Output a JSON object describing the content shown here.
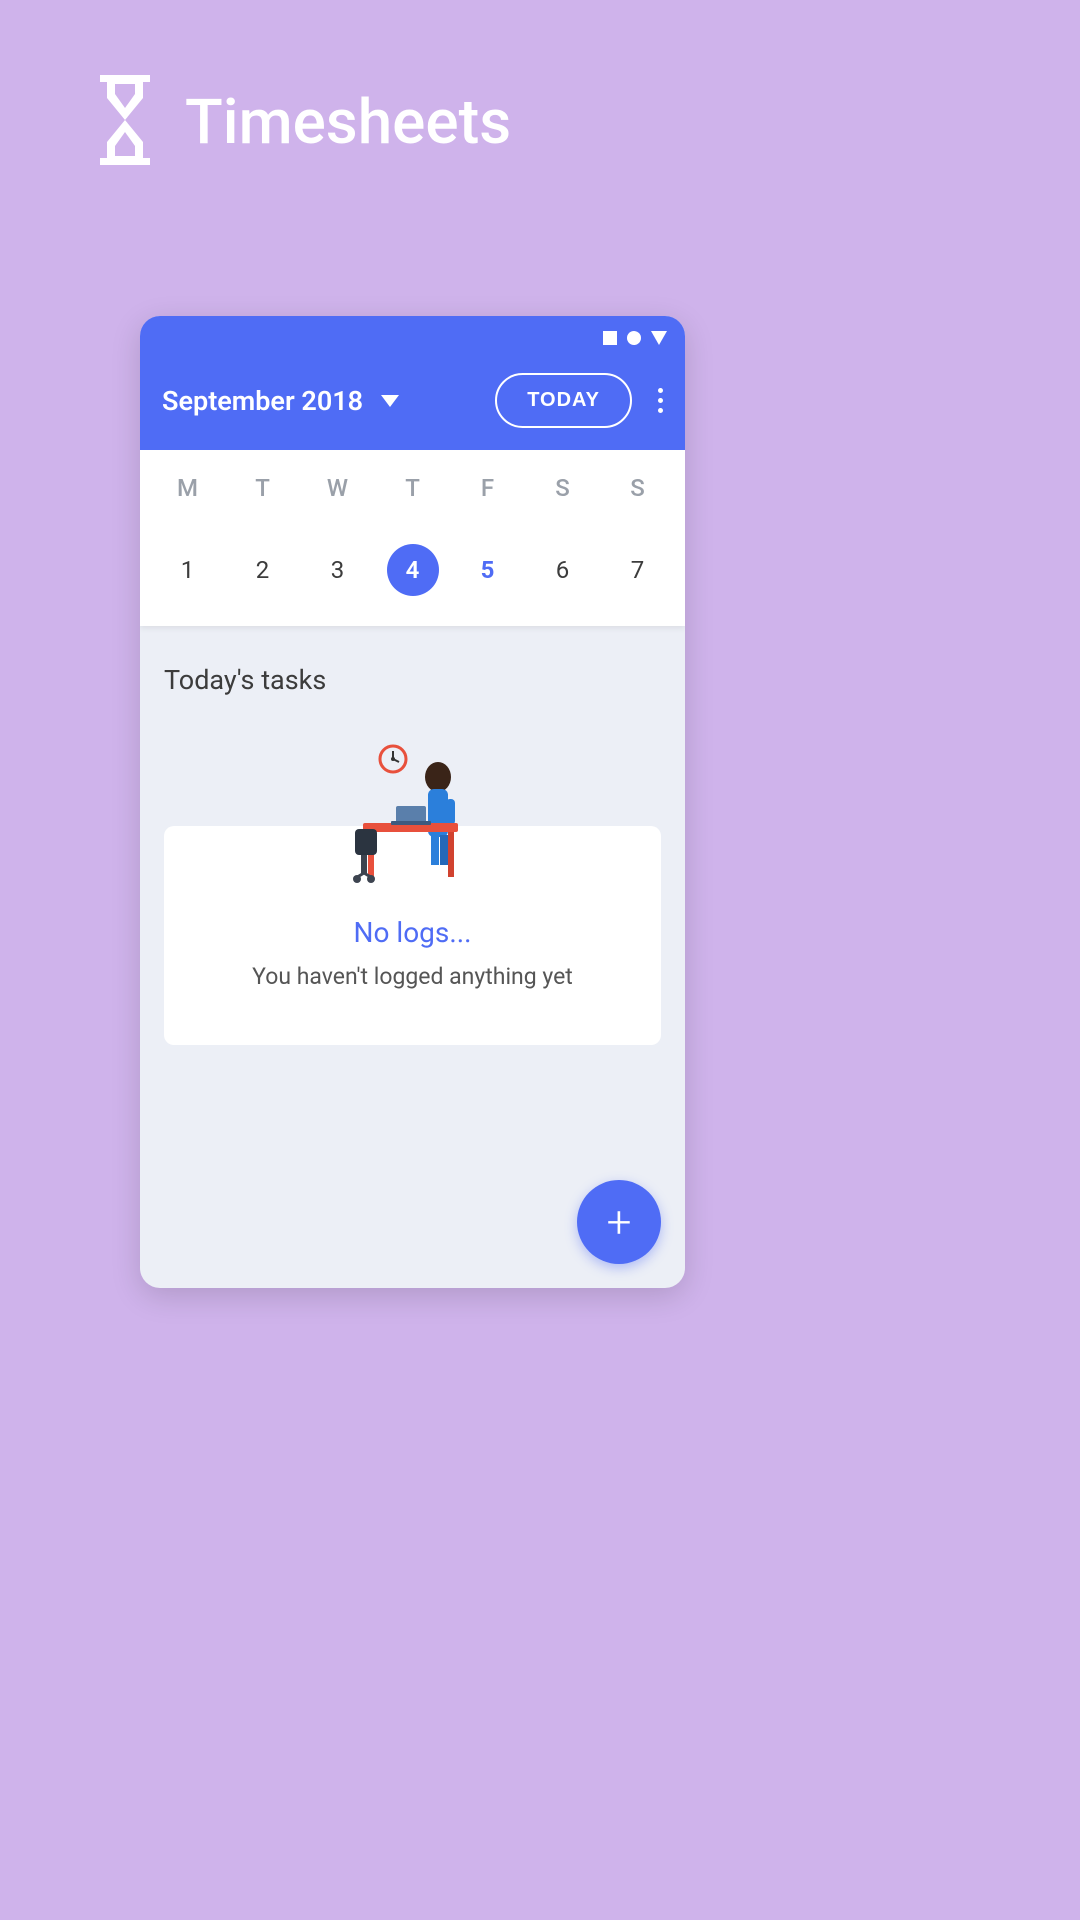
{
  "app": {
    "name": "Timesheets"
  },
  "header": {
    "month_label": "September 2018",
    "today_button": "TODAY"
  },
  "calendar": {
    "weekdays": [
      "M",
      "T",
      "W",
      "T",
      "F",
      "S",
      "S"
    ],
    "dates": [
      {
        "day": "1",
        "selected": false,
        "highlighted": false
      },
      {
        "day": "2",
        "selected": false,
        "highlighted": false
      },
      {
        "day": "3",
        "selected": false,
        "highlighted": false
      },
      {
        "day": "4",
        "selected": true,
        "highlighted": false
      },
      {
        "day": "5",
        "selected": false,
        "highlighted": true
      },
      {
        "day": "6",
        "selected": false,
        "highlighted": false
      },
      {
        "day": "7",
        "selected": false,
        "highlighted": false
      }
    ]
  },
  "tasks": {
    "section_title": "Today's tasks",
    "empty_title": "No logs...",
    "empty_subtitle": "You haven't logged anything yet"
  },
  "colors": {
    "primary": "#4F6CF5",
    "background": "#CFB3EB",
    "surface": "#ECEFF6"
  }
}
